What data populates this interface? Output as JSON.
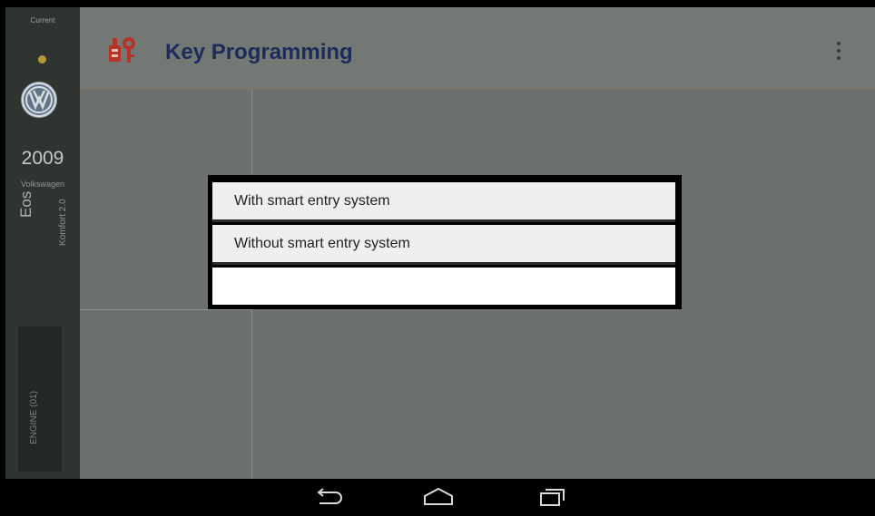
{
  "sidebar": {
    "status_label": "Current",
    "year": "2009",
    "make": "Volkswagen",
    "model": "Eos",
    "trim": "Komfort 2.0",
    "module": "ENGINE (01)",
    "status_color": "#b69a35"
  },
  "header": {
    "title": "Key Programming",
    "accent_color": "#1c2b5a"
  },
  "dialog": {
    "options": [
      {
        "label": "With smart entry system"
      },
      {
        "label": "Without smart entry system"
      }
    ]
  },
  "navbar": {
    "buttons": [
      "back-icon",
      "home-icon",
      "recents-icon"
    ]
  }
}
